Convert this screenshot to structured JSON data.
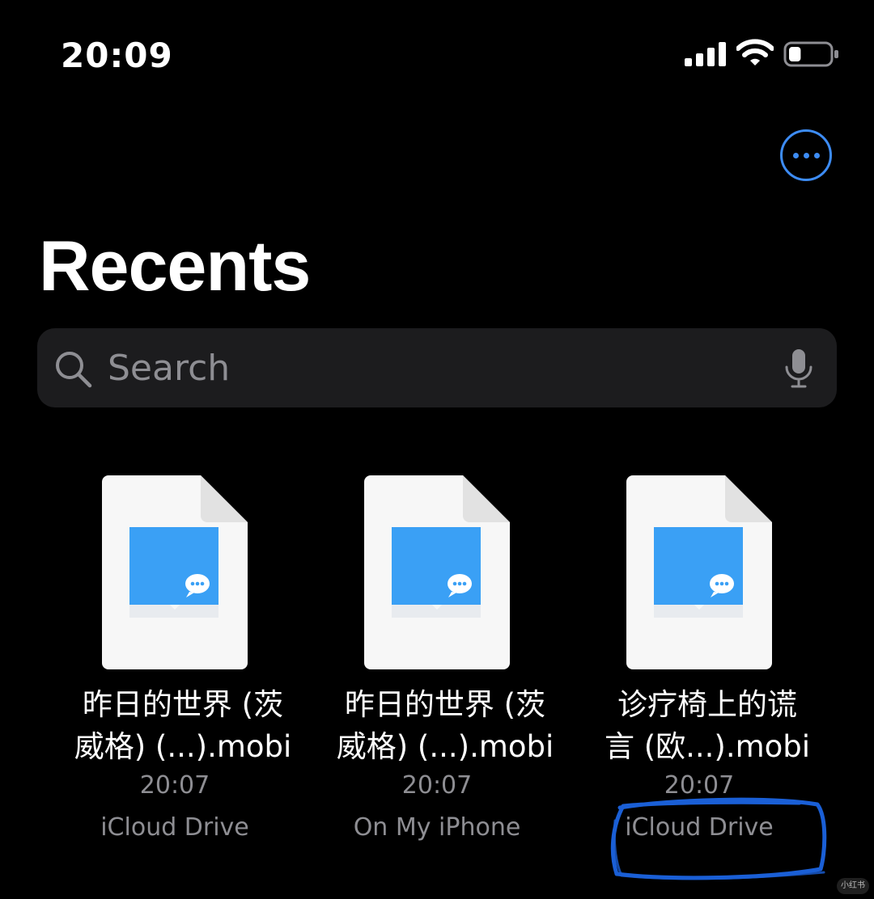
{
  "status_bar": {
    "time": "20:09",
    "battery_level": 0.3
  },
  "header": {
    "title": "Recents"
  },
  "search": {
    "placeholder": "Search"
  },
  "files": [
    {
      "name_line1": "昨日的世界 (茨",
      "name_line2": "威格) (...).mobi",
      "time": "20:07",
      "location": "iCloud Drive"
    },
    {
      "name_line1": "昨日的世界 (茨",
      "name_line2": "威格) (...).mobi",
      "time": "20:07",
      "location": "On My iPhone"
    },
    {
      "name_line1": "诊疗椅上的谎",
      "name_line2": "言 (欧...).mobi",
      "time": "20:07",
      "location": "iCloud Drive"
    }
  ],
  "colors": {
    "accent": "#3d8cf5",
    "annotation": "#1a5fd6",
    "book_blue": "#3aa0f5"
  }
}
